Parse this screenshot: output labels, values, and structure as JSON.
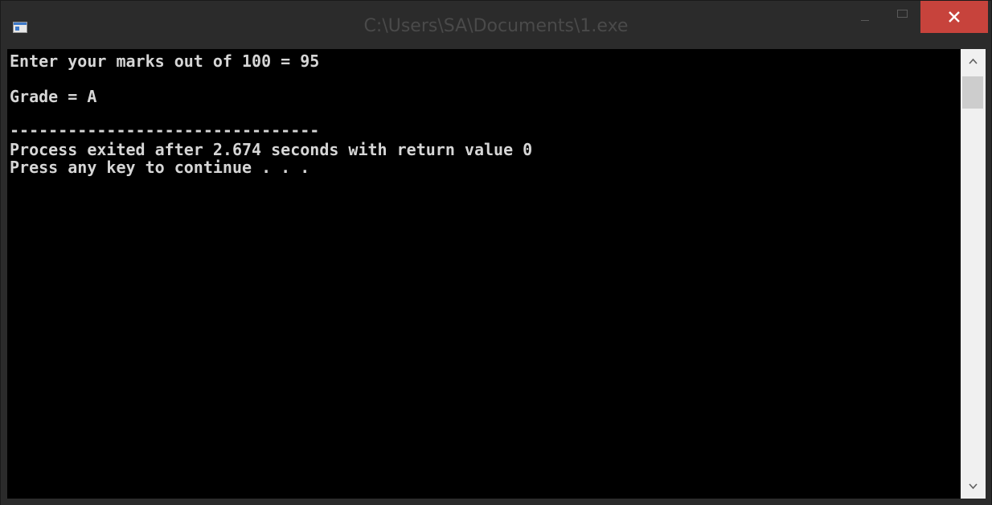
{
  "window": {
    "title": "C:\\Users\\SA\\Documents\\1.exe",
    "icon": "console-app-icon",
    "controls": {
      "minimize_icon": "minimize-icon",
      "maximize_icon": "maximize-icon",
      "close_icon": "close-icon"
    }
  },
  "console": {
    "lines": [
      "Enter your marks out of 100 = 95",
      "Grade = A",
      "--------------------------------",
      "Process exited after 2.674 seconds with return value 0",
      "Press any key to continue . . ."
    ]
  },
  "scrollbar": {
    "up_icon": "chevron-up-icon",
    "down_icon": "chevron-down-icon"
  },
  "colors": {
    "titlebar": "#2b2b2b",
    "close_button": "#c7433c",
    "console_background": "#000000",
    "console_text": "#d6d6d6",
    "scrollbar_track": "#f0f0f0"
  }
}
